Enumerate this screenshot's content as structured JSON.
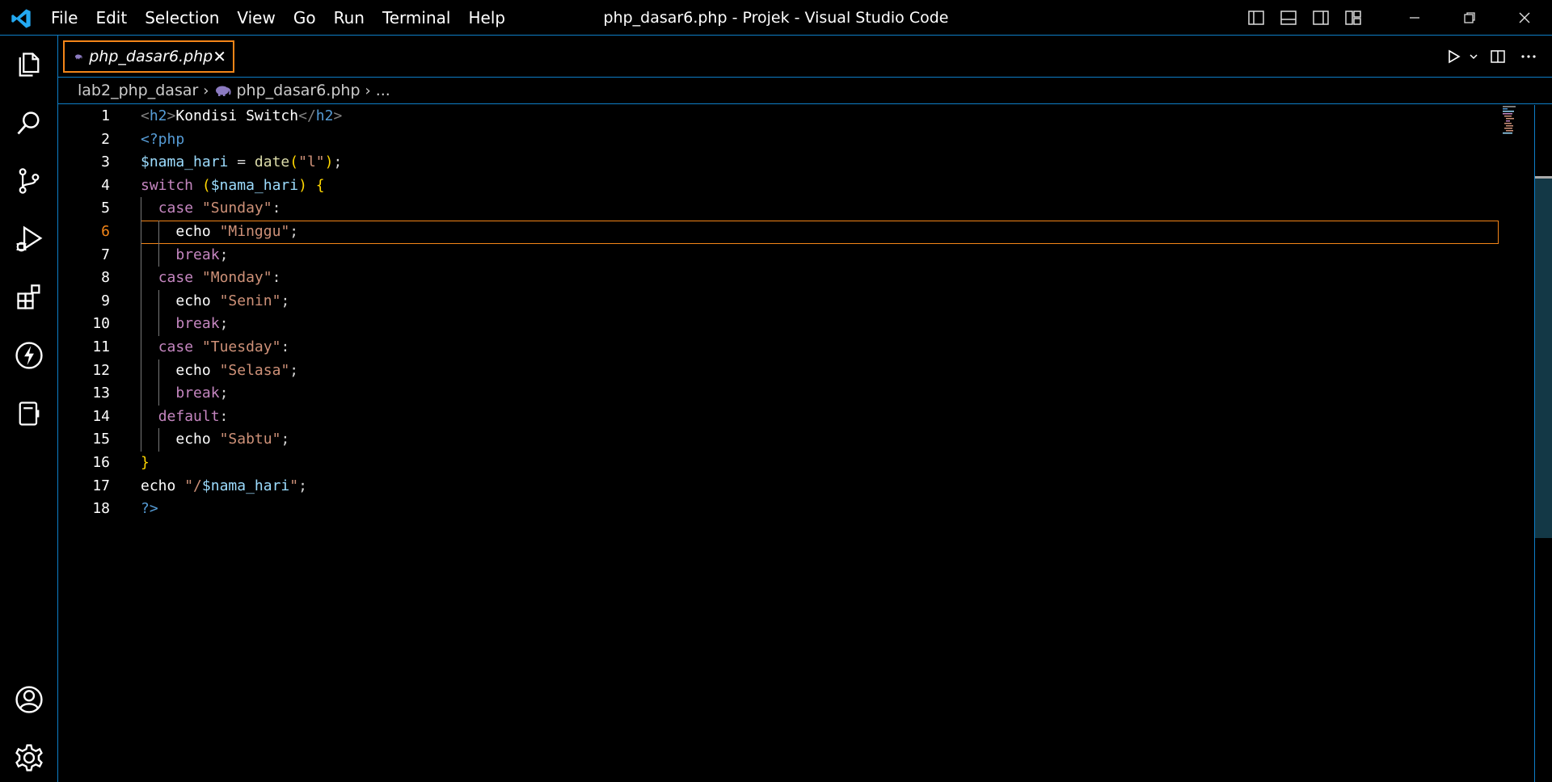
{
  "titlebar": {
    "menu": [
      "File",
      "Edit",
      "Selection",
      "View",
      "Go",
      "Run",
      "Terminal",
      "Help"
    ],
    "window_title": "php_dasar6.php - Projek - Visual Studio Code"
  },
  "tabs": [
    {
      "label": "php_dasar6.php",
      "icon": "php-elephant-icon",
      "active": true,
      "preview": true
    }
  ],
  "breadcrumb": {
    "folder": "lab2_php_dasar",
    "file": "php_dasar6.php",
    "more": "..."
  },
  "editor": {
    "active_line": 6,
    "line_numbers": [
      "1",
      "2",
      "3",
      "4",
      "5",
      "6",
      "7",
      "8",
      "9",
      "10",
      "11",
      "12",
      "13",
      "14",
      "15",
      "16",
      "17",
      "18"
    ],
    "lines": [
      "<h2>Kondisi Switch</h2>",
      "<?php",
      "$nama_hari = date(\"l\");",
      "switch ($nama_hari) {",
      "  case \"Sunday\":",
      "    echo \"Minggu\";",
      "    break;",
      "  case \"Monday\":",
      "    echo \"Senin\";",
      "    break;",
      "  case \"Tuesday\":",
      "    echo \"Selasa\";",
      "    break;",
      "  default:",
      "    echo \"Sabtu\";",
      "}",
      "echo \"/$nama_hari\";",
      "?>"
    ]
  },
  "colors": {
    "accent_border": "#0e7ec7",
    "active_tab_border": "#f38518",
    "background": "#000000"
  }
}
